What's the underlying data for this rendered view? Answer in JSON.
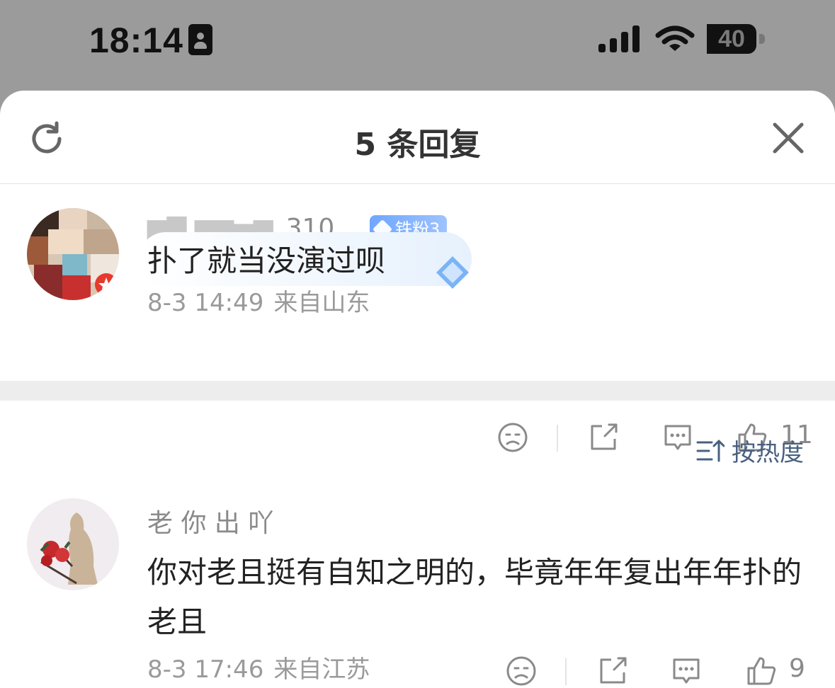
{
  "status_bar": {
    "time": "18:14",
    "battery_level": "40",
    "battery_percent": 40
  },
  "sheet": {
    "title": "5 条回复"
  },
  "reply": {
    "username": "_310",
    "badge": "铁粉3",
    "text": "扑了就当没演过呗",
    "date": "8-3 14:49",
    "location": "来自山东",
    "likes": "11"
  },
  "sort": {
    "label": "按热度"
  },
  "comments": [
    {
      "username": "老 你 出 吖",
      "text": "你对老且挺有自知之明的，毕竟年年复出年年扑的老且",
      "date": "8-3 17:46",
      "location": "来自江苏",
      "likes": "9"
    }
  ]
}
